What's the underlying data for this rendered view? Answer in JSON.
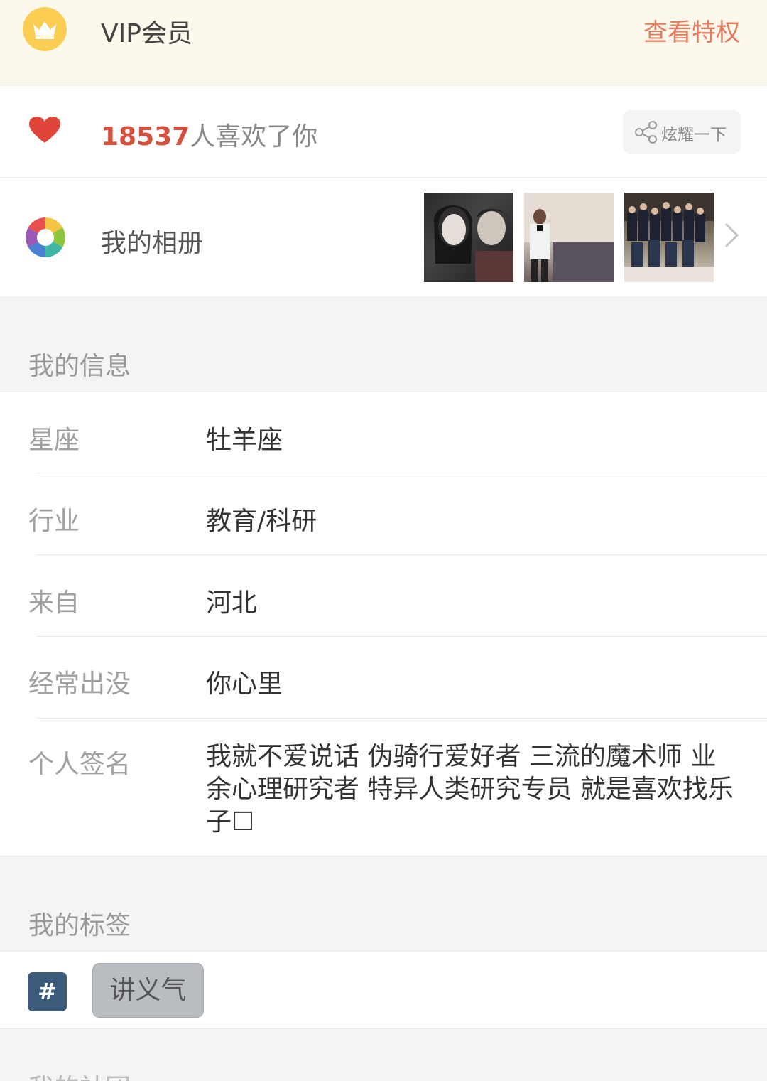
{
  "vip": {
    "title": "VIP会员",
    "link": "查看特权",
    "icon": "crown-icon"
  },
  "likes": {
    "count": "18537",
    "suffix": "人喜欢了你",
    "share_label": "炫耀一下",
    "icon": "heart-icon",
    "share_icon": "share-icon"
  },
  "album": {
    "title": "我的相册",
    "photo_count": 3,
    "icon": "color-wheel-icon"
  },
  "info": {
    "heading": "我的信息",
    "rows": [
      {
        "label": "星座",
        "value": "牡羊座"
      },
      {
        "label": "行业",
        "value": "教育/科研"
      },
      {
        "label": "来自",
        "value": "河北"
      },
      {
        "label": "经常出没",
        "value": "你心里"
      },
      {
        "label": "个人签名",
        "value": "我就不爱说话 伪骑行爱好者 三流的魔术师 业余心理研究者 特异人类研究专员 就是喜欢找乐子☐"
      }
    ]
  },
  "tags": {
    "heading": "我的标签",
    "hash": "#",
    "items": [
      "讲义气"
    ]
  },
  "next_section": {
    "heading": "我的社团"
  },
  "colors": {
    "accent": "#e5795d",
    "likes": "#d5503c",
    "vip_bg": "#fdf8ec",
    "crown": "#fbcd52"
  }
}
